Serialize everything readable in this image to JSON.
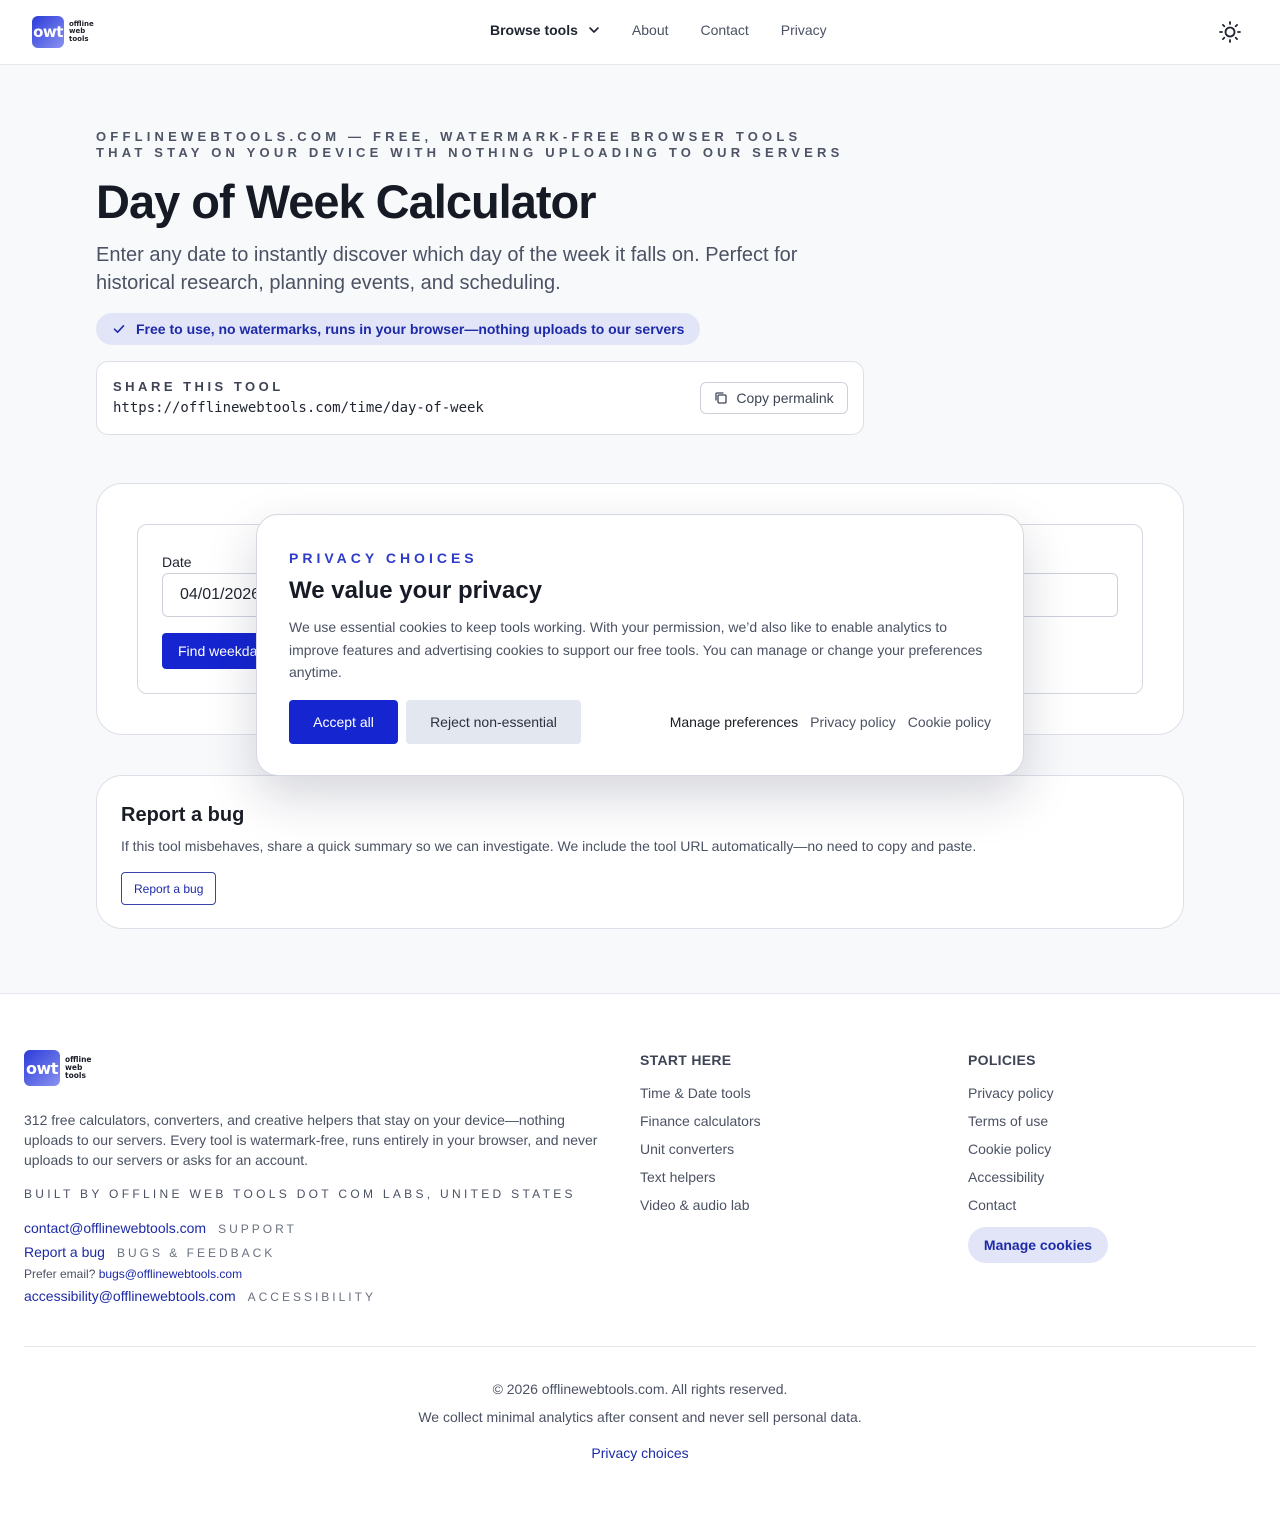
{
  "header": {
    "logo_badge": "owt",
    "logo_lines": [
      "offline",
      "web",
      "tools"
    ],
    "nav": {
      "browse": "Browse tools",
      "about": "About",
      "contact": "Contact",
      "privacy": "Privacy"
    },
    "theme_icon": "sun-icon"
  },
  "hero": {
    "eyebrow": "OFFLINEWEBTOOLS.COM — FREE, WATERMARK-FREE BROWSER TOOLS THAT STAY ON YOUR DEVICE WITH NOTHING UPLOADING TO OUR SERVERS",
    "title": "Day of Week Calculator",
    "subtitle": "Enter any date to instantly discover which day of the week it falls on. Perfect for historical research, planning events, and scheduling.",
    "pill": "Free to use, no watermarks, runs in your browser—nothing uploads to our servers"
  },
  "share": {
    "label": "SHARE THIS TOOL",
    "url": "https://offlinewebtools.com/time/day-of-week",
    "copy_label": "Copy permalink"
  },
  "tool": {
    "date_label": "Date",
    "date_value": "04/01/2026",
    "find_label": "Find weekday"
  },
  "report": {
    "title": "Report a bug",
    "description": "If this tool misbehaves, share a quick summary so we can investigate. We include the tool URL automatically—no need to copy and paste.",
    "button": "Report a bug"
  },
  "cookie_modal": {
    "eyebrow": "PRIVACY CHOICES",
    "title": "We value your privacy",
    "body": "We use essential cookies to keep tools working. With your permission, we’d also like to enable analytics to improve features and advertising cookies to support our free tools. You can manage or change your preferences anytime.",
    "accept": "Accept all",
    "reject": "Reject non-essential",
    "manage": "Manage preferences",
    "privacy_policy": "Privacy policy",
    "cookie_policy": "Cookie policy"
  },
  "footer": {
    "description": "312 free calculators, converters, and creative helpers that stay on your device—nothing uploads to our servers. Every tool is watermark-free, runs entirely in your browser, and never uploads to our servers or asks for an account.",
    "built_by": "BUILT BY OFFLINE WEB TOOLS DOT COM LABS, UNITED STATES",
    "contact_email": "contact@offlinewebtools.com",
    "contact_tag": "SUPPORT",
    "report_link": "Report a bug",
    "report_tag": "BUGS & FEEDBACK",
    "prefer_email_label": "Prefer email?",
    "bugs_email": "bugs@offlinewebtools.com",
    "accessibility_email": "accessibility@offlinewebtools.com",
    "accessibility_tag": "ACCESSIBILITY",
    "start_here": {
      "title": "START HERE",
      "items": [
        "Time & Date tools",
        "Finance calculators",
        "Unit converters",
        "Text helpers",
        "Video & audio lab"
      ]
    },
    "policies": {
      "title": "POLICIES",
      "items": [
        "Privacy policy",
        "Terms of use",
        "Cookie policy",
        "Accessibility",
        "Contact"
      ]
    },
    "manage_cookies": "Manage cookies",
    "copyright": "© 2026 offlinewebtools.com. All rights reserved.",
    "analytics_note": "We collect minimal analytics after consent and never sell personal data.",
    "privacy_choices": "Privacy choices"
  },
  "colors": {
    "accent": "#1525d0",
    "link": "#1d2aa8",
    "pill_bg": "#e2e5f7"
  }
}
